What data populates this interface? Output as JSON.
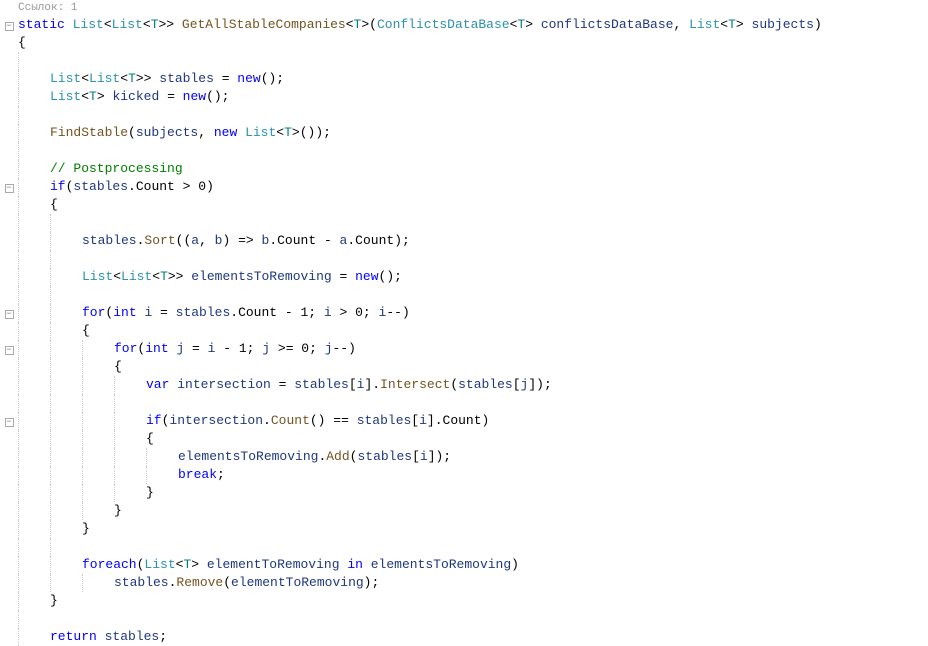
{
  "codelens": "Ссылок: 1",
  "lines": {
    "l1": {
      "static": "static",
      "list1": "List",
      "list2": "List",
      "t1": "T",
      "method": "GetAllStableCompanies",
      "t2": "T",
      "paramType": "ConflictsDataBase",
      "t3": "T",
      "param1": "conflictsDataBase",
      "list3": "List",
      "t4": "T",
      "param2": "subjects"
    },
    "l4": {
      "list1": "List",
      "list2": "List",
      "t": "T",
      "var": "stables",
      "eq": " = ",
      "new": "new"
    },
    "l5": {
      "list": "List",
      "t": "T",
      "var": "kicked",
      "eq": " = ",
      "new": "new"
    },
    "l7": {
      "method": "FindStable",
      "arg1": "subjects",
      "new": "new",
      "list": "List",
      "t": "T"
    },
    "l9": {
      "comment": "// Postprocessing"
    },
    "l10": {
      "if": "if",
      "var": "stables",
      "prop": "Count"
    },
    "l13": {
      "var": "stables",
      "method": "Sort",
      "a": "a",
      "b": "b",
      "b2": "b",
      "cnt": "Count",
      "a2": "a",
      "cnt2": "Count"
    },
    "l15": {
      "list1": "List",
      "list2": "List",
      "t": "T",
      "var": "elementsToRemoving",
      "new": "new"
    },
    "l17": {
      "for": "for",
      "int": "int",
      "i": "i",
      "stables": "stables",
      "count": "Count",
      "i2": "i",
      "i3": "i"
    },
    "l19": {
      "for": "for",
      "int": "int",
      "j": "j",
      "i": "i",
      "j2": "j",
      "j3": "j"
    },
    "l21": {
      "var": "var",
      "name": "intersection",
      "stables": "stables",
      "i": "i",
      "method": "Intersect",
      "stables2": "stables",
      "j": "j"
    },
    "l23": {
      "if": "if",
      "var": "intersection",
      "method": "Count",
      "stables": "stables",
      "i": "i",
      "count": "Count"
    },
    "l25": {
      "var": "elementsToRemoving",
      "method": "Add",
      "stables": "stables",
      "i": "i"
    },
    "l26": {
      "break": "break"
    },
    "l31": {
      "foreach": "foreach",
      "list": "List",
      "t": "T",
      "item": "elementToRemoving",
      "in": "in",
      "coll": "elementsToRemoving"
    },
    "l32": {
      "var": "stables",
      "method": "Remove",
      "arg": "elementToRemoving"
    },
    "l35": {
      "return": "return",
      "var": "stables"
    }
  }
}
